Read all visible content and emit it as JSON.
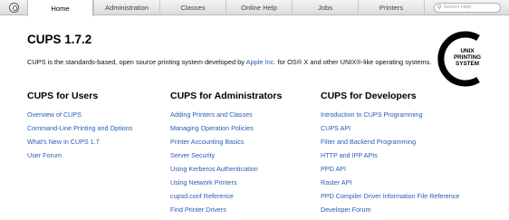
{
  "nav": {
    "logo_icon": "cups-logo-icon",
    "tabs": [
      {
        "label": "Home",
        "active": true
      },
      {
        "label": "Administration",
        "active": false
      },
      {
        "label": "Classes",
        "active": false
      },
      {
        "label": "Online Help",
        "active": false
      },
      {
        "label": "Jobs",
        "active": false
      },
      {
        "label": "Printers",
        "active": false
      }
    ],
    "search": {
      "placeholder": "Search Help",
      "icon": "search-icon"
    }
  },
  "header": {
    "title": "CUPS 1.7.2",
    "intro_prefix": "CUPS is the standards-based, open source printing system developed by ",
    "intro_link": "Apple Inc.",
    "intro_suffix": " for OS® X and other UNIX®-like operating systems."
  },
  "logo": {
    "line1": "UNIX",
    "line2": "PRINTING",
    "line3": "SYSTEM"
  },
  "columns": [
    {
      "title": "CUPS for Users",
      "links": [
        "Overview of CUPS",
        "Command-Line Printing and Options",
        "What's New in CUPS 1.7",
        "User Forum"
      ]
    },
    {
      "title": "CUPS for Administrators",
      "links": [
        "Adding Printers and Classes",
        "Managing Operation Policies",
        "Printer Accounting Basics",
        "Server Security",
        "Using Kerberos Authentication",
        "Using Network Printers",
        "cupsd.conf Reference",
        "Find Printer Drivers"
      ]
    },
    {
      "title": "CUPS for Developers",
      "links": [
        "Introduction to CUPS Programming",
        "CUPS API",
        "Filter and Backend Programming",
        "HTTP and IPP APIs",
        "PPD API",
        "Raster API",
        "PPD Compiler Driver Information File Reference",
        "Developer Forum"
      ]
    }
  ],
  "colors": {
    "link": "#2a5bb4",
    "nav_bg": "#e6e6e6"
  }
}
